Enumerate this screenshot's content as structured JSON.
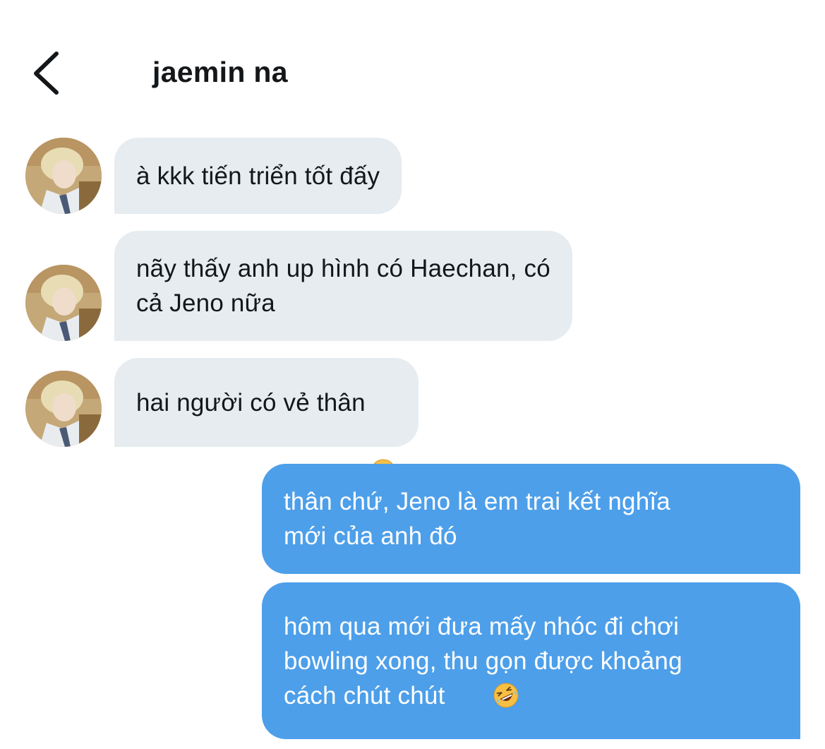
{
  "header": {
    "title": "jaemin na",
    "back_icon": "chevron-left-icon"
  },
  "colors": {
    "received_bubble": "#e6ecf0",
    "sent_bubble": "#4d9fe9",
    "text": "#14171a"
  },
  "messages": [
    {
      "from": "jaemin na",
      "direction": "received",
      "text": "à kkk tiến triển tốt đấy"
    },
    {
      "from": "jaemin na",
      "direction": "received",
      "text": "nãy thấy anh up hình có Haechan, có\ncả Jeno nữa"
    },
    {
      "from": "jaemin na",
      "direction": "received",
      "text": "hai người có vẻ thân",
      "emoji": "thinking-face-emoji"
    },
    {
      "direction": "sent",
      "text": "thân chứ, Jeno là em trai kết nghĩa\nmới của anh đó"
    },
    {
      "direction": "sent",
      "text": "hôm qua mới đưa mấy nhóc đi chơi\nbowling xong, thu gọn được khoảng\ncách chút chút",
      "emoji": "rolling-on-floor-laughing-emoji"
    }
  ]
}
